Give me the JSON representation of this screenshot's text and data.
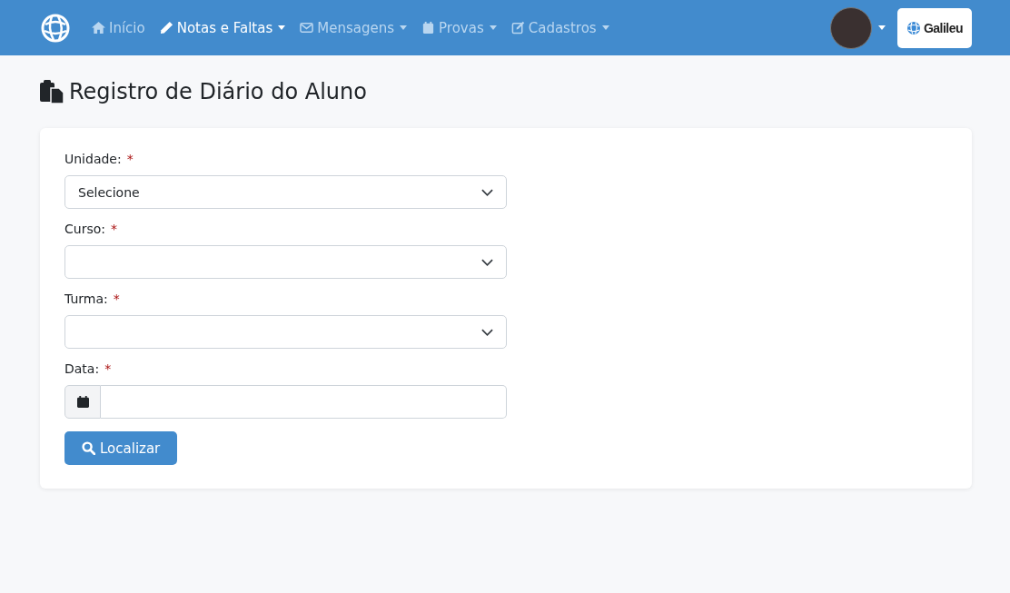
{
  "navbar": {
    "items": [
      {
        "label": "Início",
        "selected": false,
        "dropdown": false
      },
      {
        "label": "Notas e Faltas",
        "selected": true,
        "dropdown": true
      },
      {
        "label": "Mensagens",
        "selected": false,
        "dropdown": true
      },
      {
        "label": "Provas",
        "selected": false,
        "dropdown": true
      },
      {
        "label": "Cadastros",
        "selected": false,
        "dropdown": true
      }
    ],
    "brand": "Galileu"
  },
  "page_title": "Registro de Diário do Aluno",
  "form": {
    "fields": [
      {
        "kind": "select",
        "label": "Unidade:",
        "required_mark": "*",
        "value": "Selecione"
      },
      {
        "kind": "select",
        "label": "Curso:",
        "required_mark": "*"
      },
      {
        "kind": "select",
        "label": "Turma:",
        "required_mark": "*"
      },
      {
        "kind": "date",
        "label": "Data:",
        "required_mark": "*"
      }
    ],
    "submit": "Localizar"
  }
}
